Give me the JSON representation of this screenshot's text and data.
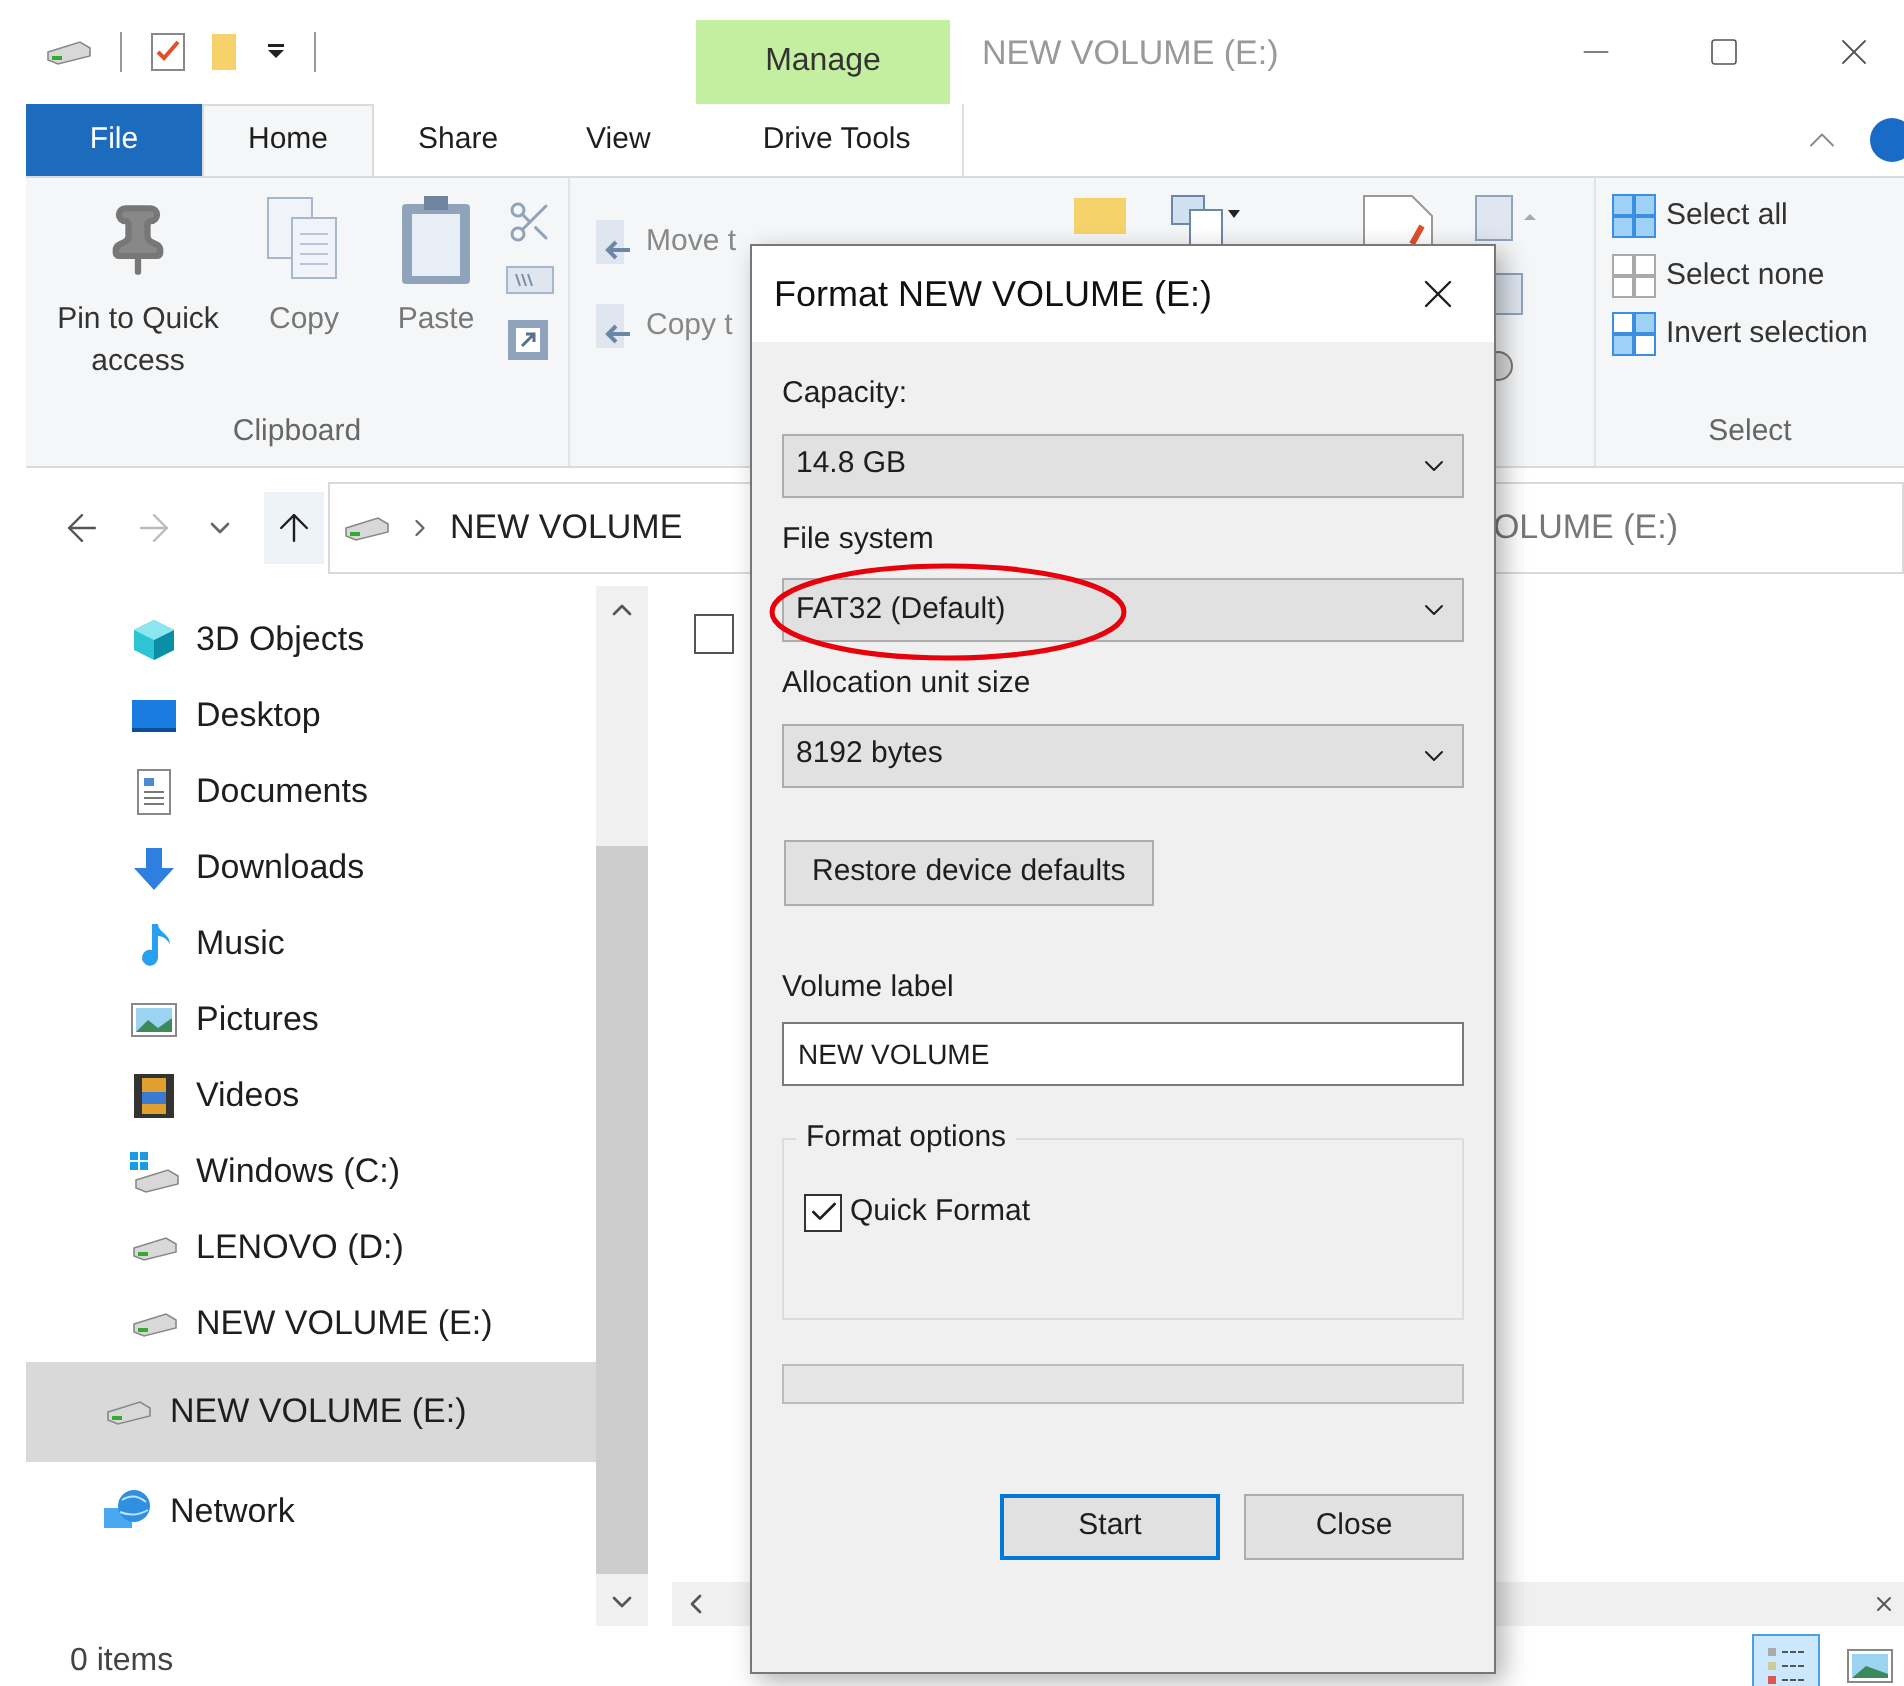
{
  "window": {
    "title": "NEW VOLUME (E:)"
  },
  "context_tab": {
    "group": "Manage",
    "label": "Drive Tools",
    "selected": false
  },
  "ribbon_tabs": [
    {
      "label": "File",
      "kind": "file",
      "selected": false
    },
    {
      "label": "Home",
      "kind": "tab",
      "selected": true
    },
    {
      "label": "Share",
      "kind": "tab",
      "selected": false
    },
    {
      "label": "View",
      "kind": "tab",
      "selected": false
    }
  ],
  "clipboard": {
    "label": "Clipboard",
    "buttons": [
      "Pin to Quick access",
      "Copy",
      "Paste"
    ]
  },
  "organize": {
    "buttons": [
      "Move t",
      "Copy t"
    ]
  },
  "select": {
    "label": "Select",
    "buttons": [
      "Select all",
      "Select none",
      "Invert selection"
    ]
  },
  "address_bar": {
    "path": "NEW VOLUME"
  },
  "search": {
    "placeholder": "OLUME (E:)"
  },
  "content": {
    "select_all_checked": false
  },
  "sidebar": {
    "items": [
      {
        "label": "3D Objects",
        "kind": "sub",
        "selected": false
      },
      {
        "label": "Desktop",
        "kind": "sub",
        "selected": false
      },
      {
        "label": "Documents",
        "kind": "sub",
        "selected": false
      },
      {
        "label": "Downloads",
        "kind": "sub",
        "selected": false
      },
      {
        "label": "Music",
        "kind": "sub",
        "selected": false
      },
      {
        "label": "Pictures",
        "kind": "sub",
        "selected": false
      },
      {
        "label": "Videos",
        "kind": "sub",
        "selected": false
      },
      {
        "label": "Windows (C:)",
        "kind": "sub",
        "selected": false
      },
      {
        "label": "LENOVO (D:)",
        "kind": "sub",
        "selected": false
      },
      {
        "label": "NEW VOLUME (E:)",
        "kind": "sub",
        "selected": false
      },
      {
        "label": "NEW VOLUME (E:)",
        "kind": "top",
        "selected": true
      },
      {
        "label": "Network",
        "kind": "top",
        "selected": false
      }
    ]
  },
  "status_bar": {
    "items": "0 items",
    "view_buttons": [
      {
        "selected": true
      },
      {
        "selected": false
      }
    ]
  },
  "dialog": {
    "title": "Format NEW VOLUME (E:)",
    "fields": [
      {
        "label": "Capacity:",
        "value": "14.8 GB",
        "circled": false
      },
      {
        "label": "File system",
        "value": "FAT32 (Default)",
        "circled": true
      },
      {
        "label": "Allocation unit size",
        "value": "8192 bytes",
        "circled": false
      }
    ],
    "restore_button": "Restore device defaults",
    "volume_label": {
      "label": "Volume label",
      "value": "NEW VOLUME"
    },
    "format_options": {
      "title": "Format options",
      "quick_format": {
        "label": "Quick Format",
        "checked": true
      }
    },
    "progress": {
      "level": 0
    },
    "buttons": [
      {
        "label": "Start",
        "selected": true
      },
      {
        "label": "Close",
        "selected": false
      }
    ]
  }
}
